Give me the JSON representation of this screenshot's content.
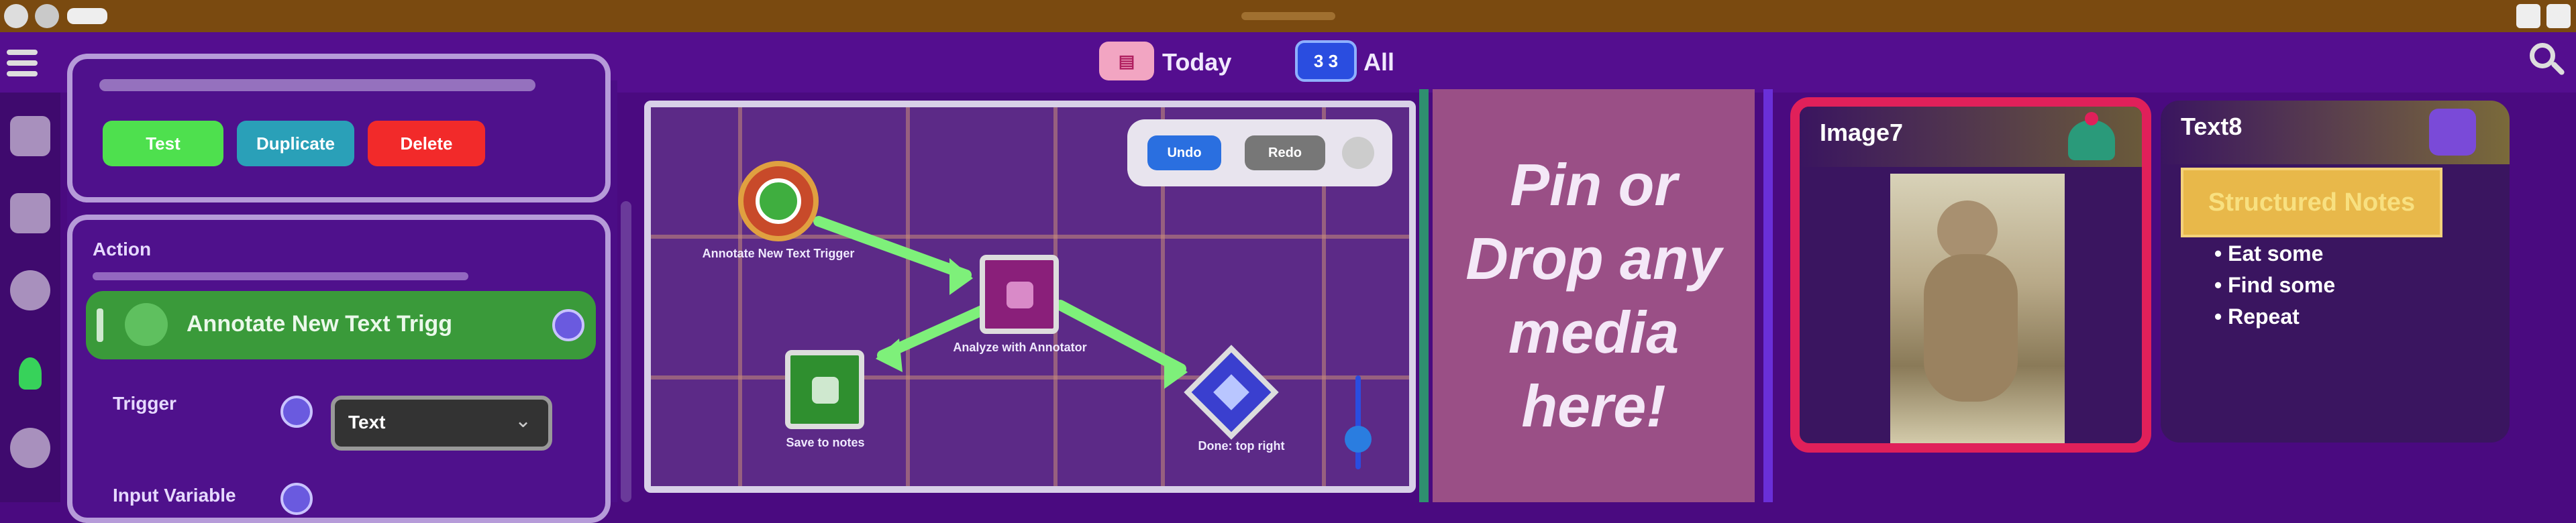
{
  "header": {
    "today_label": "Today",
    "all_label": "All",
    "all_chip_text": "3 3"
  },
  "left_panel": {
    "buttons": [
      {
        "label": "Test",
        "color": "#4ee04e"
      },
      {
        "label": "Duplicate",
        "color": "#2aa0b8"
      },
      {
        "label": "Delete",
        "color": "#f22a2a"
      }
    ],
    "section_title": "Action",
    "action_item_label": "Annotate New Text Trigg",
    "trigger_label": "Trigger",
    "trigger_value": "Text",
    "input_variable_label": "Input Variable"
  },
  "canvas": {
    "controls": {
      "left": "Undo",
      "right": "Redo"
    },
    "nodes": [
      {
        "name": "start",
        "label": "Annotate New Text Trigger"
      },
      {
        "name": "annotate",
        "label": "Analyze with Annotator"
      },
      {
        "name": "save",
        "label": "Save to notes"
      },
      {
        "name": "done",
        "label": "Done: top right"
      }
    ]
  },
  "dropzone": {
    "text": "Pin or Drop any media here!"
  },
  "image_card": {
    "title": "Image7"
  },
  "text_card": {
    "title": "Text8",
    "highlight": "Structured Notes",
    "bullets": [
      "Eat some",
      "Find some",
      "Repeat"
    ]
  },
  "colors": {
    "background": "#4a0a80",
    "topbar": "#7a4a10",
    "accent_red": "#e0205a",
    "accent_green": "#2f8f2f",
    "accent_gold": "#e8b84a"
  }
}
